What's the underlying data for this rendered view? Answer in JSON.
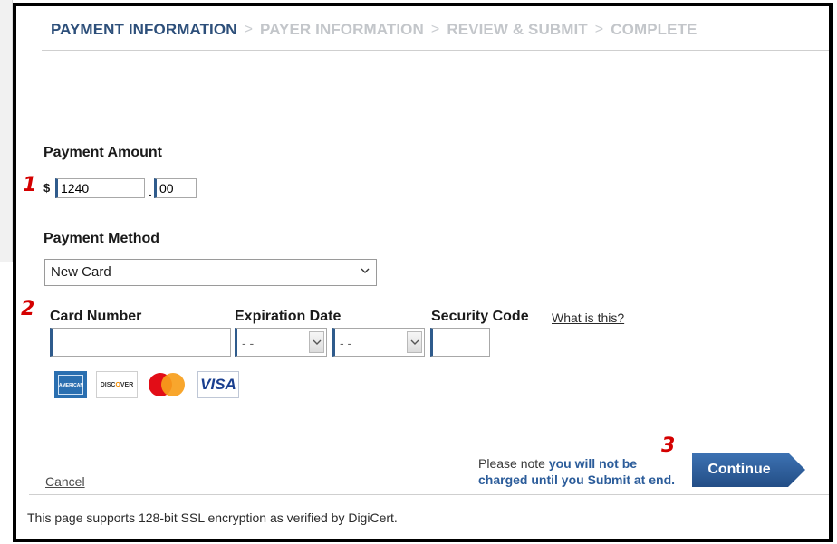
{
  "steps": {
    "items": [
      "PAYMENT INFORMATION",
      "PAYER INFORMATION",
      "REVIEW & SUBMIT",
      "COMPLETE"
    ],
    "separator": ">",
    "active_color": "#2d4f7a",
    "inactive_color": "#c3c6ca"
  },
  "markers": {
    "one": "1",
    "two": "2",
    "three": "3",
    "color": "#d40000"
  },
  "payment_amount": {
    "label": "Payment Amount",
    "currency_symbol": "$",
    "dollars": "1240",
    "decimal_point": ".",
    "cents": "00"
  },
  "payment_method": {
    "label": "Payment Method",
    "selected": "New Card"
  },
  "card": {
    "number_label": "Card Number",
    "number_value": "",
    "expiration_label": "Expiration Date",
    "month_value": "- -",
    "year_value": "- -",
    "security_label": "Security Code",
    "security_value": "",
    "help_link": "What is this?"
  },
  "card_logos": {
    "amex": "AMERICAN EXPRESS",
    "discover_prefix": "DISC",
    "discover_o": "O",
    "discover_suffix": "VER",
    "visa": "VISA"
  },
  "notice": {
    "prefix": "Please note",
    "highlight": "you will not be charged until you Submit at end."
  },
  "buttons": {
    "continue": "Continue",
    "cancel": "Cancel",
    "continue_color": "#2b5c9a"
  },
  "footer": {
    "text": "This page supports 128-bit SSL encryption as verified by DigiCert."
  }
}
